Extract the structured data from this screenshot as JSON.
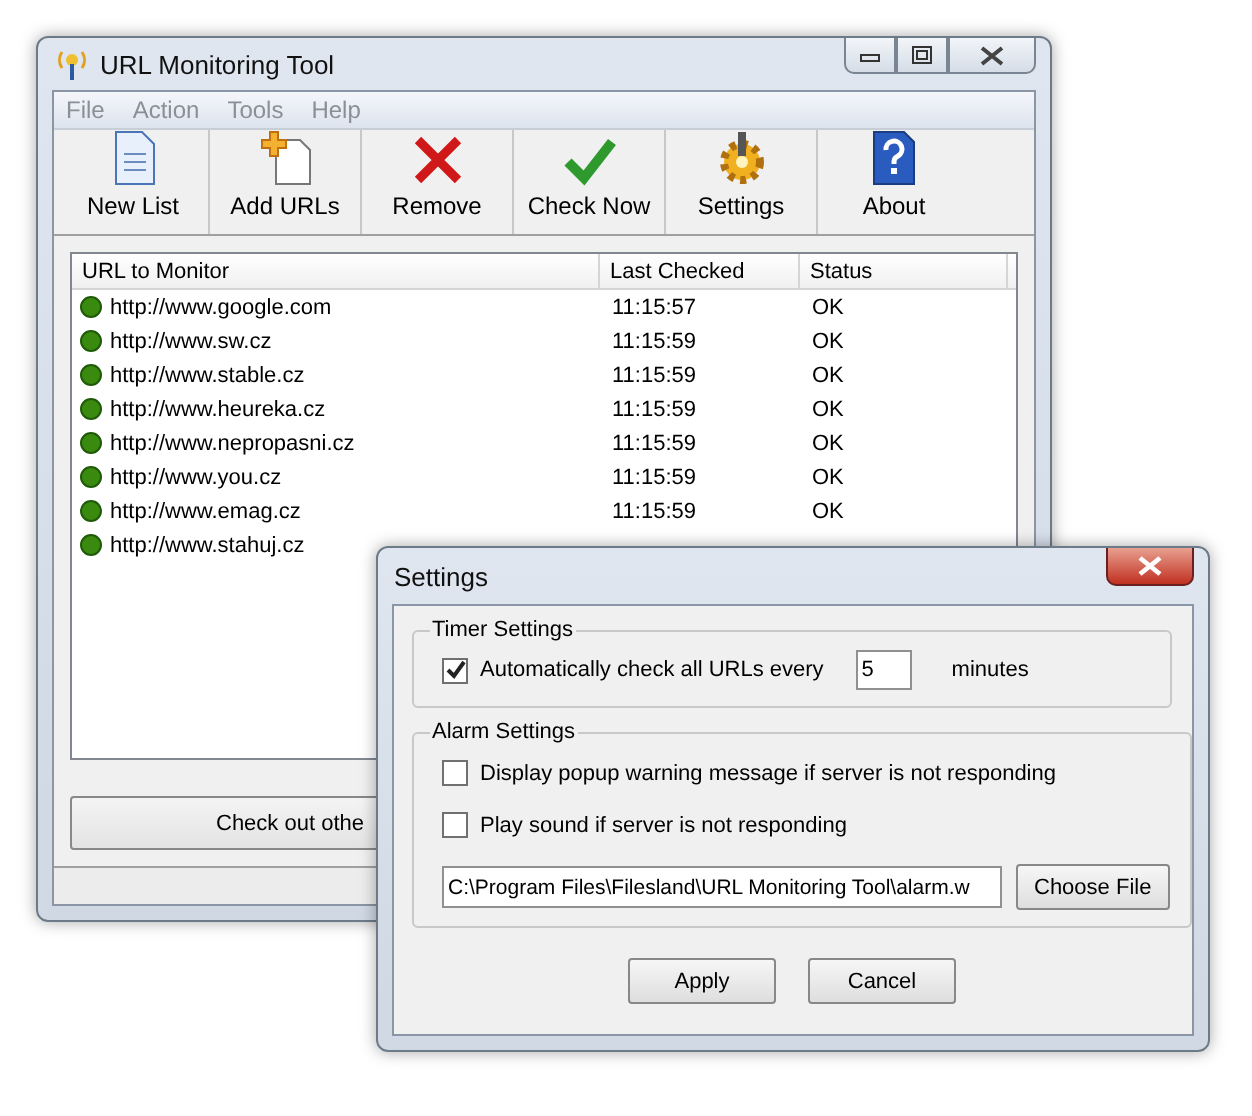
{
  "main_window": {
    "title": "URL Monitoring Tool"
  },
  "menu": [
    "File",
    "Action",
    "Tools",
    "Help"
  ],
  "toolbar": [
    {
      "label": "New List",
      "kind": "document"
    },
    {
      "label": "Add URLs",
      "kind": "add"
    },
    {
      "label": "Remove",
      "kind": "remove"
    },
    {
      "label": "Check Now",
      "kind": "check"
    },
    {
      "label": "Settings",
      "kind": "gear"
    },
    {
      "label": "About",
      "kind": "help"
    }
  ],
  "table": {
    "columns": [
      "URL to Monitor",
      "Last Checked",
      "Status"
    ],
    "rows": [
      {
        "url": "http://www.google.com",
        "last_checked": "11:15:57",
        "status": "OK"
      },
      {
        "url": "http://www.sw.cz",
        "last_checked": "11:15:59",
        "status": "OK"
      },
      {
        "url": "http://www.stable.cz",
        "last_checked": "11:15:59",
        "status": "OK"
      },
      {
        "url": "http://www.heureka.cz",
        "last_checked": "11:15:59",
        "status": "OK"
      },
      {
        "url": "http://www.nepropasni.cz",
        "last_checked": "11:15:59",
        "status": "OK"
      },
      {
        "url": "http://www.you.cz",
        "last_checked": "11:15:59",
        "status": "OK"
      },
      {
        "url": "http://www.emag.cz",
        "last_checked": "11:15:59",
        "status": "OK"
      },
      {
        "url": "http://www.stahuj.cz"
      }
    ]
  },
  "footer_button": "Check out othe",
  "settings_dialog": {
    "title": "Settings",
    "timer_group": {
      "title": "Timer Settings",
      "auto_check": {
        "label": "Automatically check all URLs every",
        "checked": true
      },
      "interval": "5",
      "unit": "minutes"
    },
    "alarm_group": {
      "title": "Alarm Settings",
      "options": [
        {
          "label": "Display popup warning message if server is not responding",
          "checked": false
        },
        {
          "label": "Play sound if server is not responding",
          "checked": false
        }
      ],
      "sound_file": "C:\\Program Files\\Filesland\\URL Monitoring Tool\\alarm.w",
      "choose_button": "Choose File"
    },
    "buttons": [
      "Apply",
      "Cancel"
    ]
  }
}
